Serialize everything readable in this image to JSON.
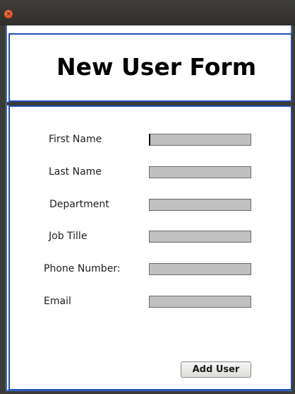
{
  "window": {
    "close_glyph": "×",
    "close_icon": "close-icon"
  },
  "header": {
    "title": "New User Form"
  },
  "form": {
    "fields": [
      {
        "label": "First Name",
        "value": ""
      },
      {
        "label": "Last Name",
        "value": ""
      },
      {
        "label": "Department",
        "value": ""
      },
      {
        "label": "Job Tille",
        "value": ""
      },
      {
        "label": "Phone Number:",
        "value": ""
      },
      {
        "label": "Email",
        "value": ""
      }
    ],
    "submit_label": "Add User"
  },
  "colors": {
    "frame": "#3c3b37",
    "panel_border": "#1f4fb4",
    "field_bg": "#c0c0c0",
    "close_button": "#dd4a1b"
  }
}
